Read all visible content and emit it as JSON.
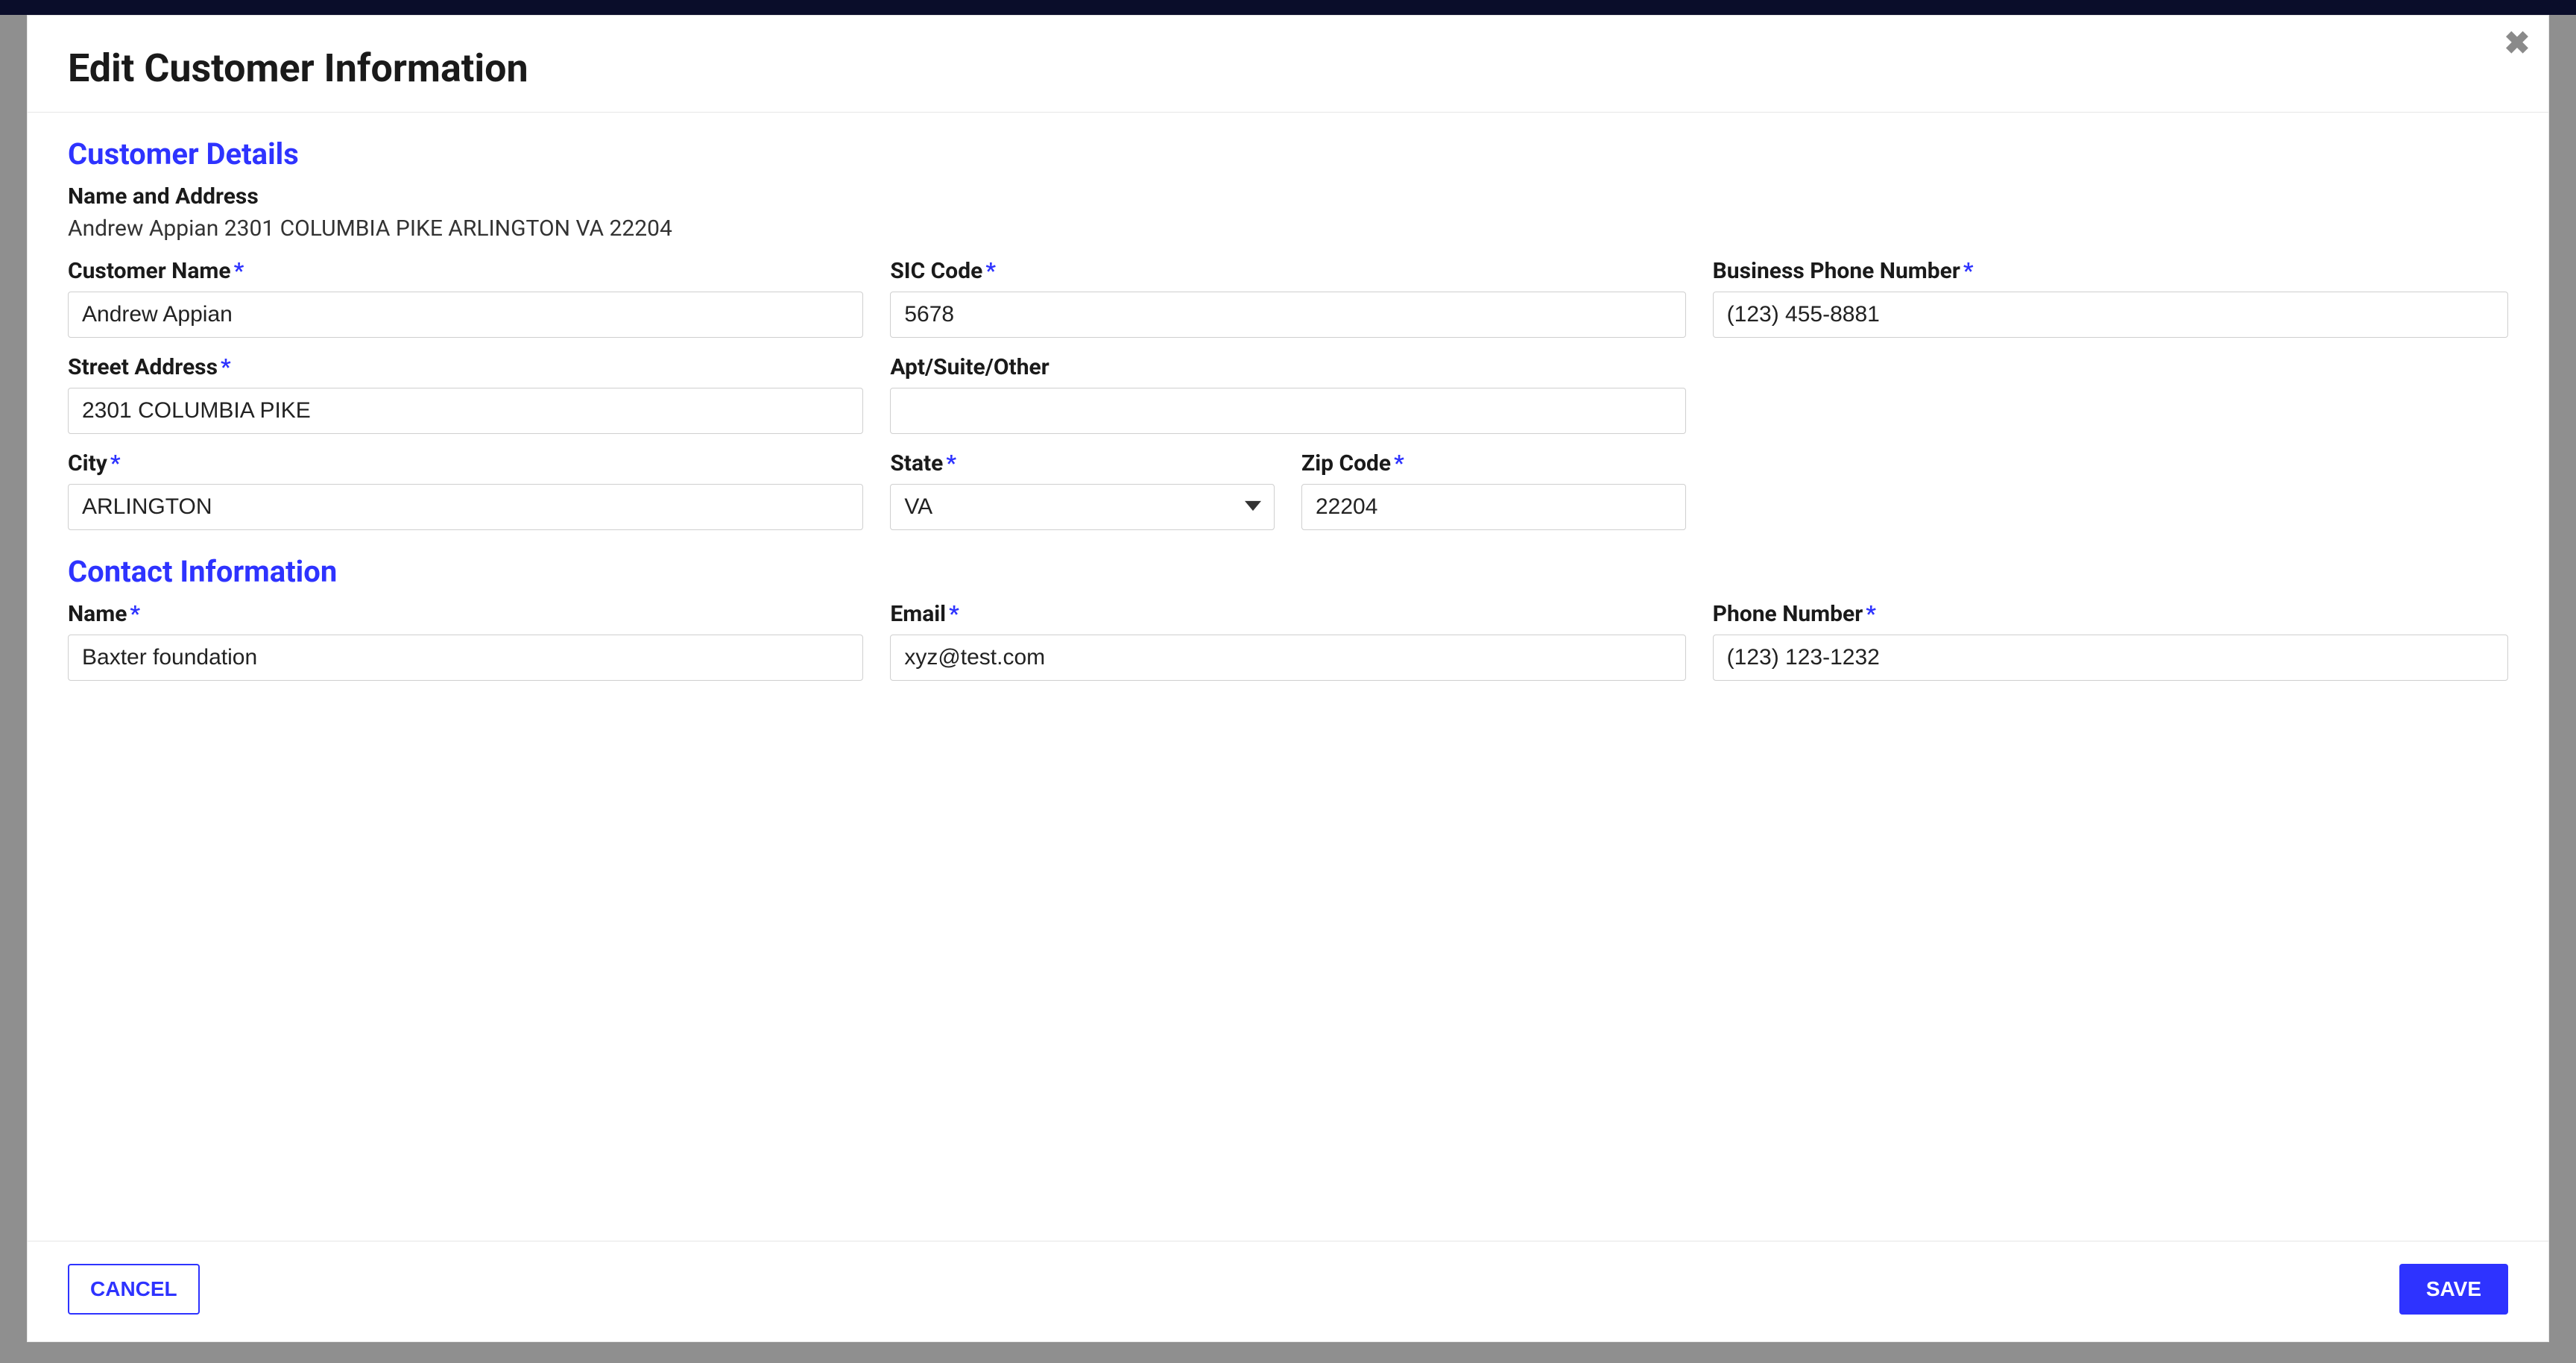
{
  "modal": {
    "title": "Edit Customer Information",
    "close_icon": "✖"
  },
  "customer_details": {
    "section_title": "Customer Details",
    "name_address_label": "Name and Address",
    "name_address_line": "Andrew Appian 2301 COLUMBIA PIKE ARLINGTON VA 22204",
    "fields": {
      "customer_name": {
        "label": "Customer Name",
        "value": "Andrew Appian",
        "required": true
      },
      "sic_code": {
        "label": "SIC Code",
        "value": "5678",
        "required": true
      },
      "business_phone": {
        "label": "Business Phone Number",
        "value": "(123) 455-8881",
        "required": true
      },
      "street_address": {
        "label": "Street Address",
        "value": "2301 COLUMBIA PIKE",
        "required": true
      },
      "apt": {
        "label": "Apt/Suite/Other",
        "value": "",
        "required": false
      },
      "city": {
        "label": "City",
        "value": "ARLINGTON",
        "required": true
      },
      "state": {
        "label": "State",
        "value": "VA",
        "required": true
      },
      "zip": {
        "label": "Zip Code",
        "value": "22204",
        "required": true
      }
    }
  },
  "contact_information": {
    "section_title": "Contact Information",
    "fields": {
      "name": {
        "label": "Name",
        "value": "Baxter foundation",
        "required": true
      },
      "email": {
        "label": "Email",
        "value": "xyz@test.com",
        "required": true
      },
      "phone": {
        "label": "Phone Number",
        "value": "(123) 123-1232",
        "required": true
      }
    }
  },
  "footer": {
    "cancel_label": "CANCEL",
    "save_label": "SAVE"
  }
}
